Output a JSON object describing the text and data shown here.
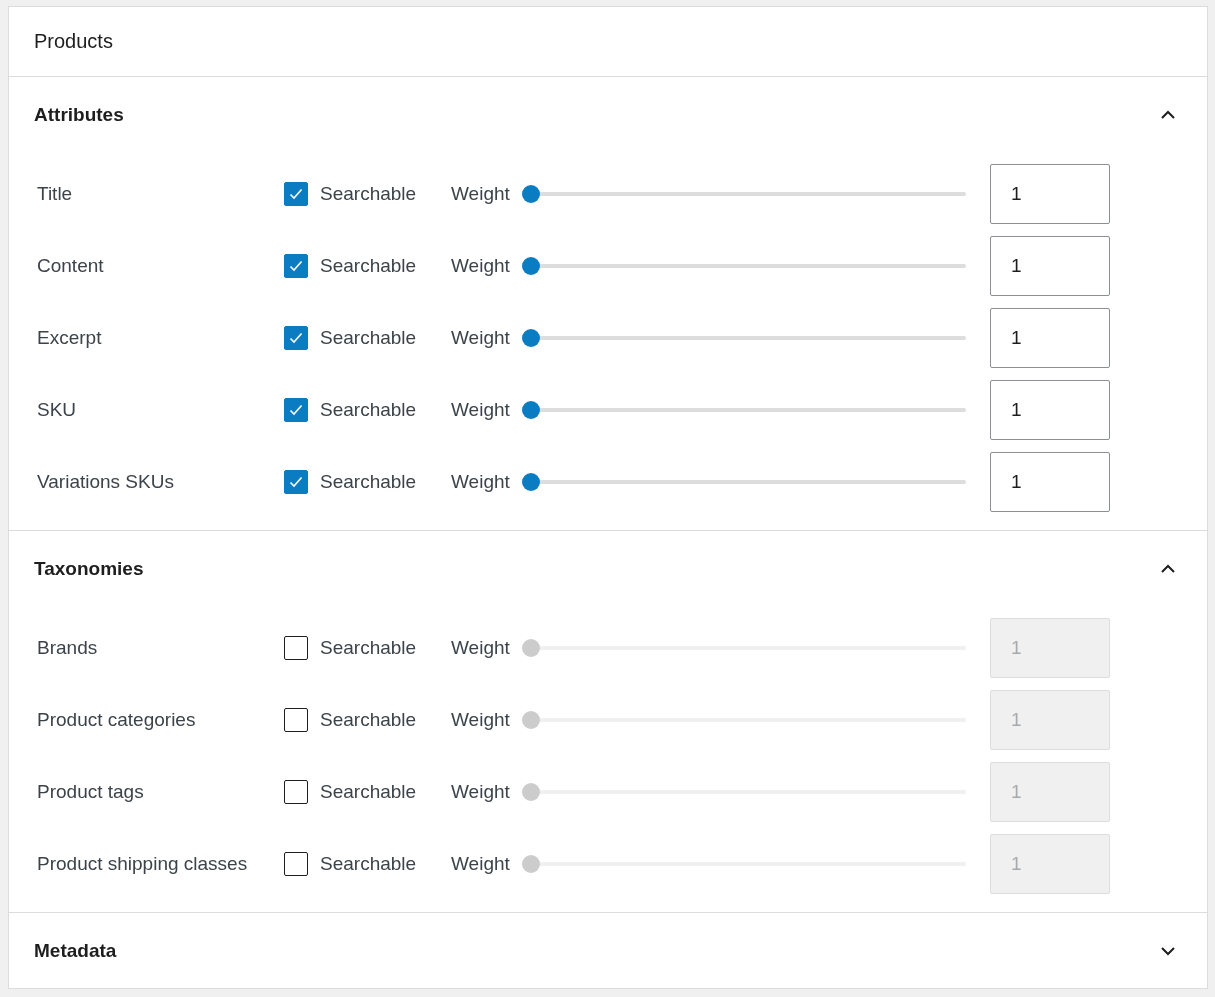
{
  "panel": {
    "title": "Products"
  },
  "sections": [
    {
      "title": "Attributes",
      "expanded": true,
      "rows": [
        {
          "label": "Title",
          "checkbox_label": "Searchable",
          "checked": true,
          "weight_label": "Weight",
          "level": 0,
          "value": "1"
        },
        {
          "label": "Content",
          "checkbox_label": "Searchable",
          "checked": true,
          "weight_label": "Weight",
          "level": 0,
          "value": "1"
        },
        {
          "label": "Excerpt",
          "checkbox_label": "Searchable",
          "checked": true,
          "weight_label": "Weight",
          "level": 0,
          "value": "1"
        },
        {
          "label": "SKU",
          "checkbox_label": "Searchable",
          "checked": true,
          "weight_label": "Weight",
          "level": 0,
          "value": "1"
        },
        {
          "label": "Variations SKUs",
          "checkbox_label": "Searchable",
          "checked": true,
          "weight_label": "Weight",
          "level": 0,
          "value": "1"
        }
      ]
    },
    {
      "title": "Taxonomies",
      "expanded": true,
      "rows": [
        {
          "label": "Brands",
          "checkbox_label": "Searchable",
          "checked": false,
          "weight_label": "Weight",
          "level": 0,
          "value": "1"
        },
        {
          "label": "Product categories",
          "checkbox_label": "Searchable",
          "checked": false,
          "weight_label": "Weight",
          "level": 0,
          "value": "1"
        },
        {
          "label": "Product tags",
          "checkbox_label": "Searchable",
          "checked": false,
          "weight_label": "Weight",
          "level": 0,
          "value": "1"
        },
        {
          "label": "Product shipping classes",
          "checkbox_label": "Searchable",
          "checked": false,
          "weight_label": "Weight",
          "level": 0,
          "value": "1"
        }
      ]
    },
    {
      "title": "Metadata",
      "expanded": false
    }
  ]
}
